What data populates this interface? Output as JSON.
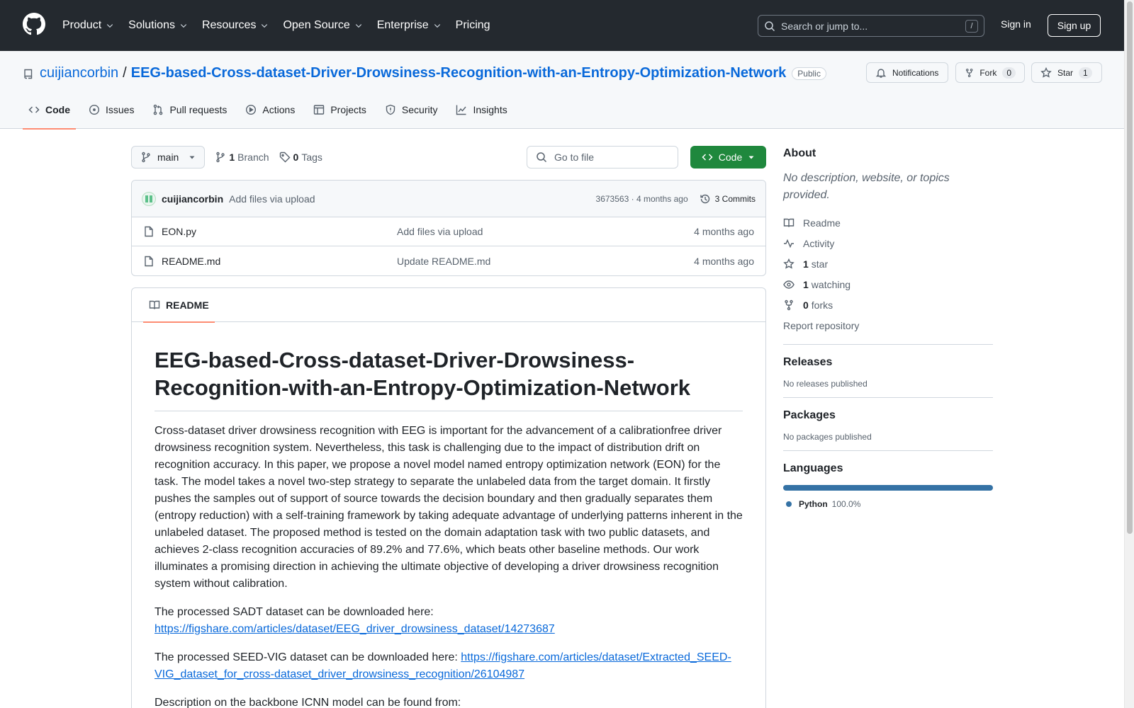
{
  "header": {
    "nav": [
      {
        "label": "Product",
        "has_menu": true
      },
      {
        "label": "Solutions",
        "has_menu": true
      },
      {
        "label": "Resources",
        "has_menu": true
      },
      {
        "label": "Open Source",
        "has_menu": true
      },
      {
        "label": "Enterprise",
        "has_menu": true
      },
      {
        "label": "Pricing",
        "has_menu": false
      }
    ],
    "search_placeholder": "Search or jump to...",
    "search_shortcut": "/",
    "sign_in": "Sign in",
    "sign_up": "Sign up"
  },
  "repo": {
    "owner": "cuijiancorbin",
    "separator": "/",
    "name": "EEG-based-Cross-dataset-Driver-Drowsiness-Recognition-with-an-Entropy-Optimization-Network",
    "visibility": "Public",
    "notifications_label": "Notifications",
    "fork_label": "Fork",
    "fork_count": "0",
    "star_label": "Star",
    "star_count": "1",
    "tabs": [
      "Code",
      "Issues",
      "Pull requests",
      "Actions",
      "Projects",
      "Security",
      "Insights"
    ],
    "active_tab": "Code"
  },
  "toolbar": {
    "branch": "main",
    "branch_count": "1",
    "branch_label": "Branch",
    "tag_count": "0",
    "tag_label": "Tags",
    "goto_placeholder": "Go to file",
    "code_button": "Code"
  },
  "latest_commit": {
    "author": "cuijiancorbin",
    "message": "Add files via upload",
    "sha": "3673563",
    "dot": "·",
    "when": "4 months ago",
    "commits_label": "3 Commits"
  },
  "files": [
    {
      "name": "EON.py",
      "message": "Add files via upload",
      "date": "4 months ago"
    },
    {
      "name": "README.md",
      "message": "Update README.md",
      "date": "4 months ago"
    }
  ],
  "readme": {
    "tab_label": "README",
    "title": "EEG-based-Cross-dataset-Driver-Drowsiness-Recognition-with-an-Entropy-Optimization-Network",
    "abstract": "Cross-dataset driver drowsiness recognition with EEG is important for the advancement of a calibrationfree driver drowsiness recognition system. Nevertheless, this task is challenging due to the impact of distribution drift on recognition accuracy. In this paper, we propose a novel model named entropy optimization network (EON) for the task. The model takes a novel two-step strategy to separate the unlabeled data from the target domain. It firstly pushes the samples out of support of source towards the decision boundary and then gradually separates them (entropy reduction) with a self-training framework by taking adequate advantage of underlying patterns inherent in the unlabeled dataset. The proposed method is tested on the domain adaptation task with two public datasets, and achieves 2-class recognition accuracies of 89.2% and 77.6%, which beats other baseline methods. Our work illuminates a promising direction in achieving the ultimate objective of developing a driver drowsiness recognition system without calibration.",
    "sadt_text": "The processed SADT dataset can be downloaded here:",
    "sadt_link": "https://figshare.com/articles/dataset/EEG_driver_drowsiness_dataset/14273687",
    "seed_text": "The processed SEED-VIG dataset can be downloaded here:",
    "seed_link": "https://figshare.com/articles/dataset/Extracted_SEED-VIG_dataset_for_cross-dataset_driver_drowsiness_recognition/26104987",
    "icnn_text": "Description on the backbone ICNN model can be found from:"
  },
  "sidebar": {
    "about_title": "About",
    "about_desc": "No description, website, or topics provided.",
    "readme_label": "Readme",
    "activity_label": "Activity",
    "stars_count": "1",
    "stars_label": "star",
    "watching_count": "1",
    "watching_label": "watching",
    "forks_count": "0",
    "forks_label": "forks",
    "report_label": "Report repository",
    "releases_title": "Releases",
    "releases_empty": "No releases published",
    "packages_title": "Packages",
    "packages_empty": "No packages published",
    "languages_title": "Languages",
    "language_name": "Python",
    "language_pct": "100.0%",
    "language_color": "#3572a5"
  }
}
